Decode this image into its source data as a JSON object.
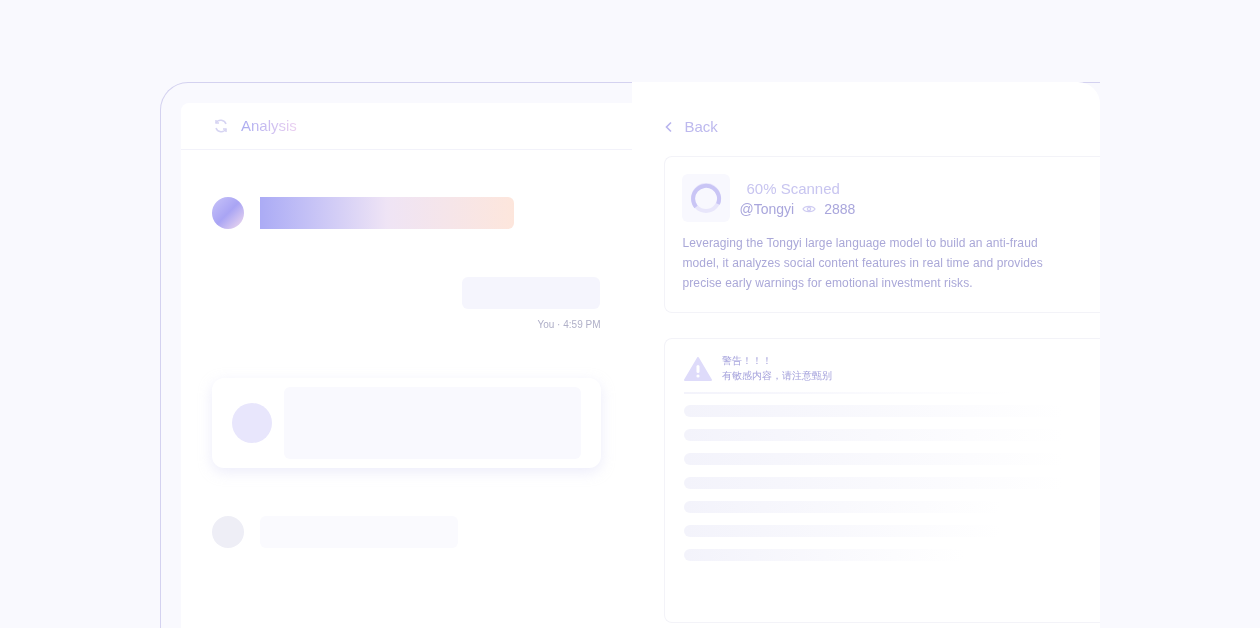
{
  "chat_panel": {
    "title": "Analysis",
    "message_meta": "You · 4:59 PM"
  },
  "detail_panel": {
    "back": "Back",
    "card": {
      "title": "60% Scanned",
      "handle": "@Tongyi",
      "views": "2888",
      "description": "Leveraging the Tongyi large language model to build an anti-fraud model, it analyzes social content features in real time and provides precise early warnings for emotional investment risks."
    },
    "warning": {
      "title": "警告！！！",
      "message": "有敏感内容，请注意甄别"
    }
  }
}
